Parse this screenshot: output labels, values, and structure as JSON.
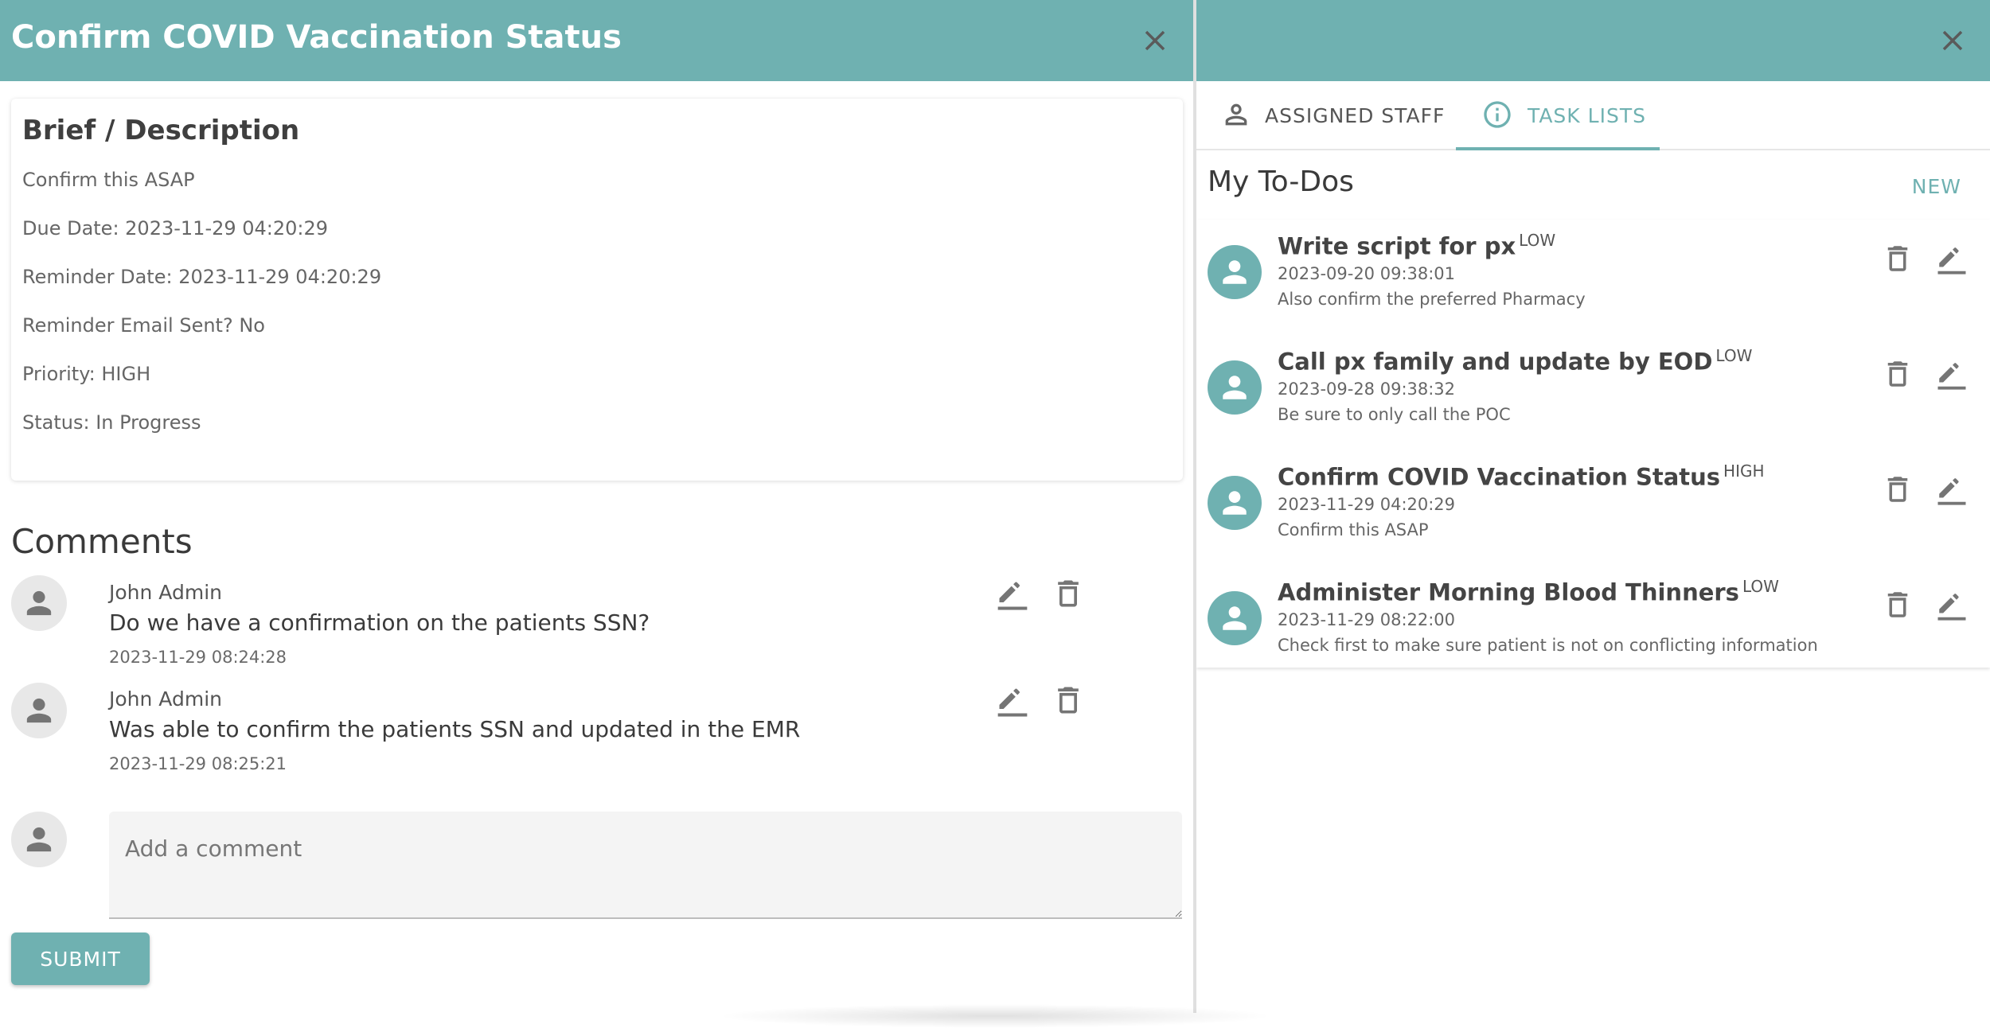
{
  "left_panel": {
    "title": "Confirm COVID Vaccination Status",
    "brief": {
      "heading": "Brief / Description",
      "description": "Confirm this ASAP",
      "due_date": "Due Date: 2023-11-29 04:20:29",
      "reminder_date": "Reminder Date: 2023-11-29 04:20:29",
      "reminder_email": "Reminder Email Sent? No",
      "priority": "Priority: HIGH",
      "status": "Status: In Progress"
    },
    "comments": {
      "heading": "Comments",
      "items": [
        {
          "author": "John Admin",
          "text": "Do we have a confirmation on the patients SSN?",
          "timestamp": "2023-11-29 08:24:28"
        },
        {
          "author": "John Admin",
          "text": "Was able to confirm the patients SSN and updated in the EMR",
          "timestamp": "2023-11-29 08:25:21"
        }
      ],
      "input_placeholder": "Add a comment",
      "submit_label": "SUBMIT"
    }
  },
  "right_panel": {
    "tabs": [
      {
        "label": "ASSIGNED STAFF",
        "icon": "person-outline-icon",
        "active": false
      },
      {
        "label": "TASK LISTS",
        "icon": "info-icon",
        "active": true
      }
    ],
    "todos": {
      "heading": "My To-Dos",
      "new_label": "NEW",
      "items": [
        {
          "title": "Write script for px",
          "priority": "LOW",
          "date": "2023-09-20 09:38:01",
          "description": "Also confirm the preferred Pharmacy"
        },
        {
          "title": "Call px family and update by EOD",
          "priority": "LOW",
          "date": "2023-09-28 09:38:32",
          "description": "Be sure to only call the POC"
        },
        {
          "title": "Confirm COVID Vaccination Status",
          "priority": "HIGH",
          "date": "2023-11-29 04:20:29",
          "description": "Confirm this ASAP"
        },
        {
          "title": "Administer Morning Blood Thinners",
          "priority": "LOW",
          "date": "2023-11-29 08:22:00",
          "description": "Check first to make sure patient is not on conflicting information"
        }
      ]
    }
  },
  "colors": {
    "accent": "#6fb1b1",
    "header_text": "#ffffff",
    "avatar_gray": "#e8e8e8",
    "icon_gray": "#757575"
  },
  "icons": {
    "close": "close-icon",
    "edit": "pencil-icon",
    "delete": "trash-icon",
    "avatar": "person-icon"
  }
}
